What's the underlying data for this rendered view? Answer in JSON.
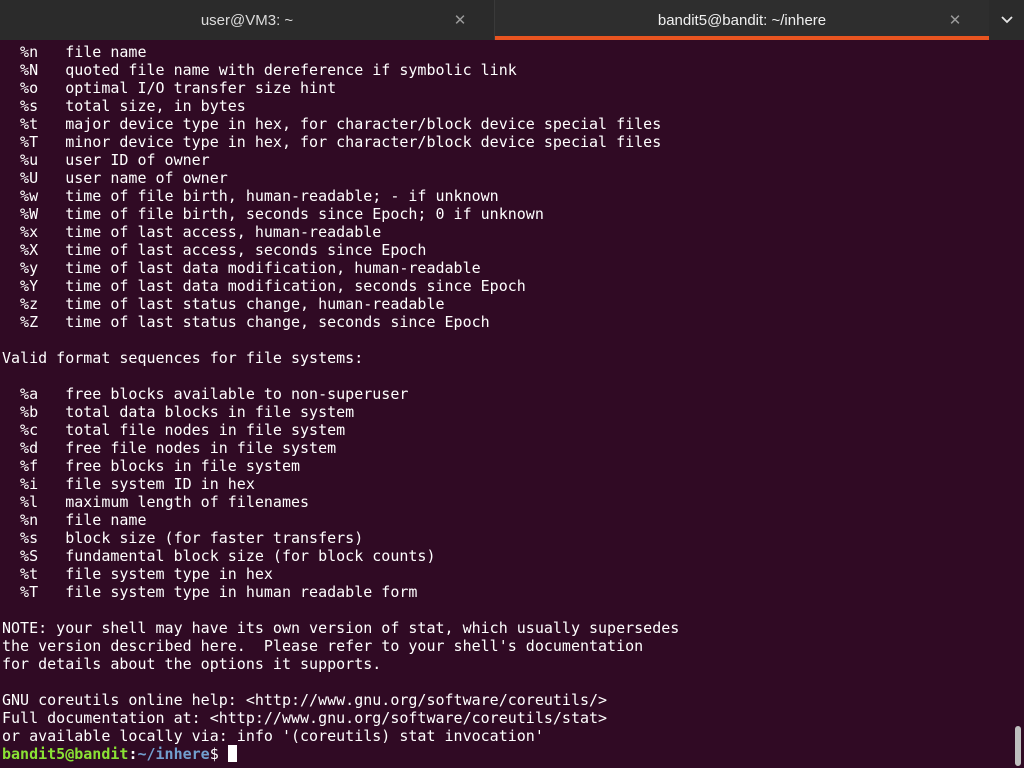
{
  "tabs": [
    {
      "title": "user@VM3: ~",
      "active": false,
      "close_glyph": "✕"
    },
    {
      "title": "bandit5@bandit: ~/inhere",
      "active": true,
      "close_glyph": "✕"
    }
  ],
  "tabs_menu_glyph": "⌄",
  "accent_color": "#e95420",
  "terminal": {
    "background": "#300a24",
    "lines": [
      "  %n   file name",
      "  %N   quoted file name with dereference if symbolic link",
      "  %o   optimal I/O transfer size hint",
      "  %s   total size, in bytes",
      "  %t   major device type in hex, for character/block device special files",
      "  %T   minor device type in hex, for character/block device special files",
      "  %u   user ID of owner",
      "  %U   user name of owner",
      "  %w   time of file birth, human-readable; - if unknown",
      "  %W   time of file birth, seconds since Epoch; 0 if unknown",
      "  %x   time of last access, human-readable",
      "  %X   time of last access, seconds since Epoch",
      "  %y   time of last data modification, human-readable",
      "  %Y   time of last data modification, seconds since Epoch",
      "  %z   time of last status change, human-readable",
      "  %Z   time of last status change, seconds since Epoch",
      "",
      "Valid format sequences for file systems:",
      "",
      "  %a   free blocks available to non-superuser",
      "  %b   total data blocks in file system",
      "  %c   total file nodes in file system",
      "  %d   free file nodes in file system",
      "  %f   free blocks in file system",
      "  %i   file system ID in hex",
      "  %l   maximum length of filenames",
      "  %n   file name",
      "  %s   block size (for faster transfers)",
      "  %S   fundamental block size (for block counts)",
      "  %t   file system type in hex",
      "  %T   file system type in human readable form",
      "",
      "NOTE: your shell may have its own version of stat, which usually supersedes",
      "the version described here.  Please refer to your shell's documentation",
      "for details about the options it supports.",
      "",
      "GNU coreutils online help: <http://www.gnu.org/software/coreutils/>",
      "Full documentation at: <http://www.gnu.org/software/coreutils/stat>",
      "or available locally via: info '(coreutils) stat invocation'"
    ],
    "prompt": {
      "user_host": "bandit5@bandit",
      "colon": ":",
      "path": "~/inhere",
      "symbol": "$"
    }
  }
}
